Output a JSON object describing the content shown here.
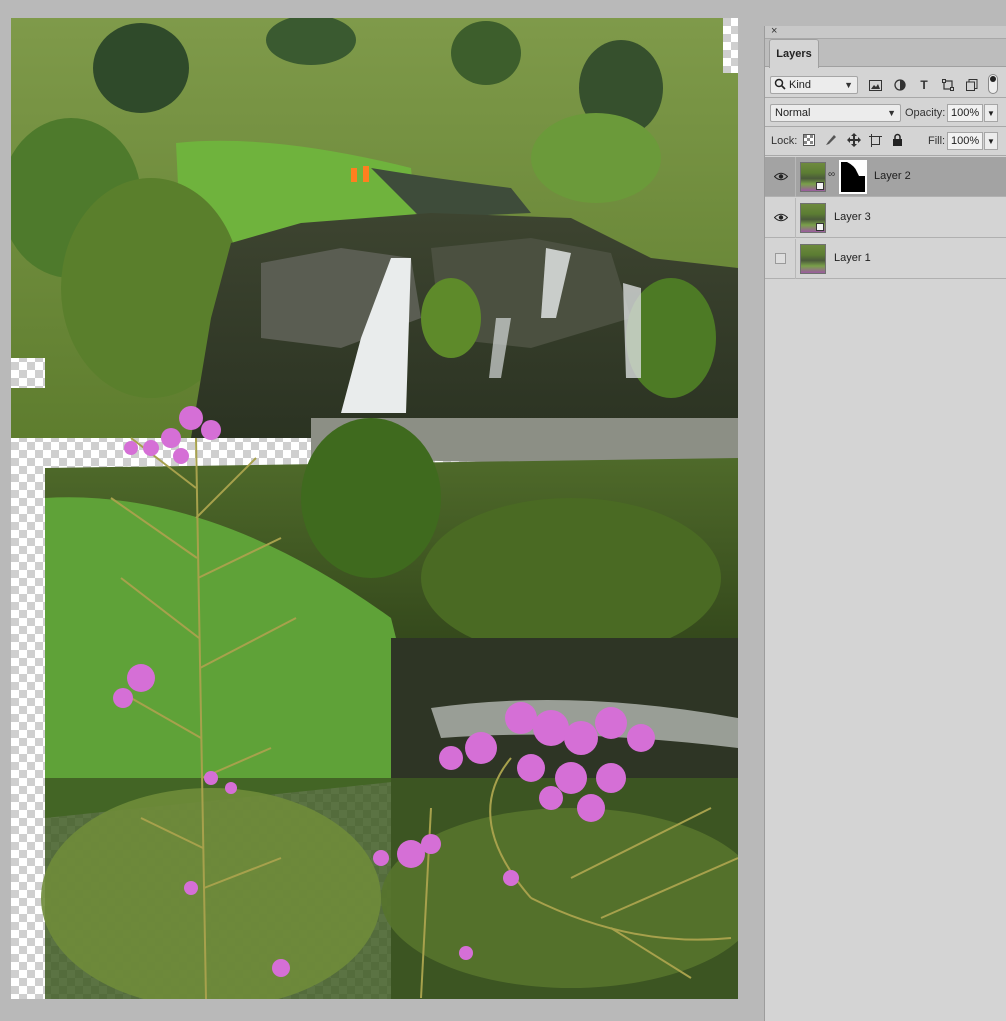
{
  "panel": {
    "close_glyph": "×",
    "tab_label": "Layers",
    "filter": {
      "kind_label": "Kind",
      "icons": [
        "image-filter-icon",
        "adjustment-filter-icon",
        "type-filter-icon",
        "shape-filter-icon",
        "smartobject-filter-icon"
      ],
      "type_glyph": "T"
    },
    "blend_mode": "Normal",
    "opacity_label": "Opacity:",
    "opacity_value": "100%",
    "lock_label": "Lock:",
    "fill_label": "Fill:",
    "fill_value": "100%",
    "layers": [
      {
        "name": "Layer 2",
        "visible": true,
        "selected": true,
        "has_mask": true
      },
      {
        "name": "Layer 3",
        "visible": true,
        "selected": false,
        "has_mask": false
      },
      {
        "name": "Layer 1",
        "visible": false,
        "selected": false,
        "has_mask": false
      }
    ]
  },
  "colors": {
    "panel_bg": "#d4d4d4",
    "selected_row": "#a3a3a3",
    "workspace_bg": "#b9b9b9",
    "flower_pink": "#d56fd6"
  },
  "canvas": {
    "transparency": "checkerboard",
    "content": "photo"
  }
}
